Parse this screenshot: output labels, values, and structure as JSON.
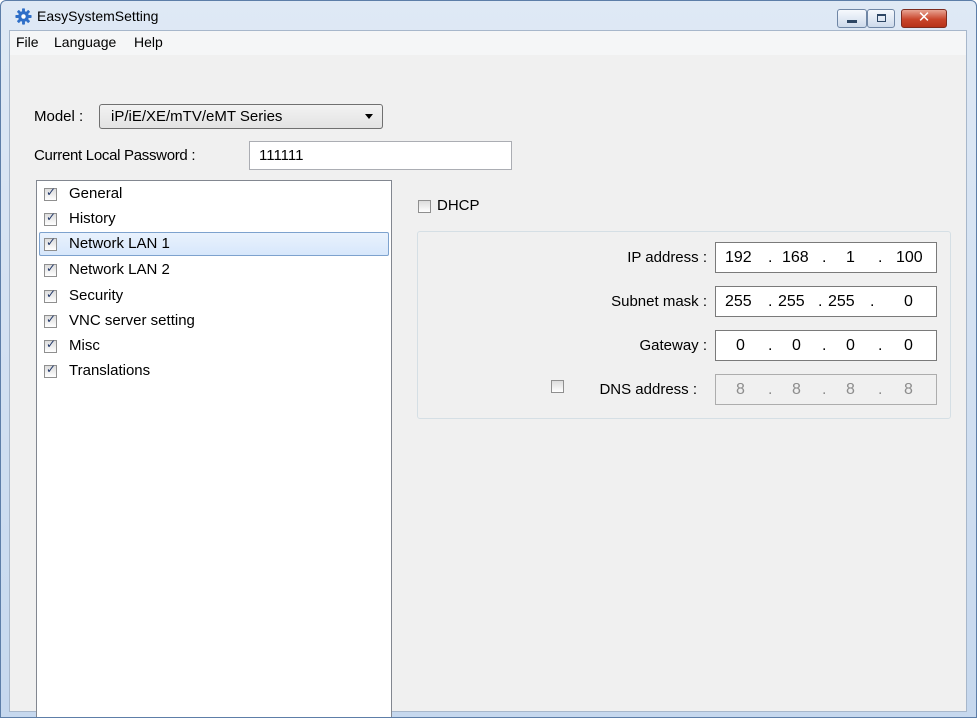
{
  "window": {
    "title": "EasySystemSetting",
    "close_glyph": "✕"
  },
  "menu": [
    "File",
    "Language",
    "Help"
  ],
  "model": {
    "label": "Model :",
    "value": "iP/iE/XE/mTV/eMT Series"
  },
  "password": {
    "label": "Current Local Password :",
    "value": "111111"
  },
  "sections": [
    {
      "label": "General",
      "checked": true
    },
    {
      "label": "History",
      "checked": true
    },
    {
      "label": "Network LAN 1",
      "checked": true,
      "selected": true
    },
    {
      "label": "Network LAN 2",
      "checked": true
    },
    {
      "label": "Security",
      "checked": true
    },
    {
      "label": "VNC server setting",
      "checked": true
    },
    {
      "label": "Misc",
      "checked": true
    },
    {
      "label": "Translations",
      "checked": true
    }
  ],
  "check_glyph": "✓",
  "network": {
    "dhcp_label": "DHCP",
    "dhcp_checked": false,
    "ip_label": "IP address :",
    "ip": [
      "192",
      "168",
      "1",
      "100"
    ],
    "subnet_label": "Subnet mask :",
    "subnet": [
      "255",
      "255",
      "255",
      "0"
    ],
    "gateway_label": "Gateway :",
    "gateway": [
      "0",
      "0",
      "0",
      "0"
    ],
    "dns_label": "DNS address :",
    "dns_checked": false,
    "dns": [
      "8",
      "8",
      "8",
      "8"
    ],
    "dot": "."
  },
  "icons": {
    "app": "gear-icon",
    "minimize": "minimize-icon",
    "maximize": "maximize-icon",
    "close": "close-icon",
    "dropdown": "chevron-down-icon"
  },
  "colors": {
    "title_bg": "#dfe9f5",
    "close_btn": "#c9452b",
    "selection_border": "#7da2ce"
  }
}
